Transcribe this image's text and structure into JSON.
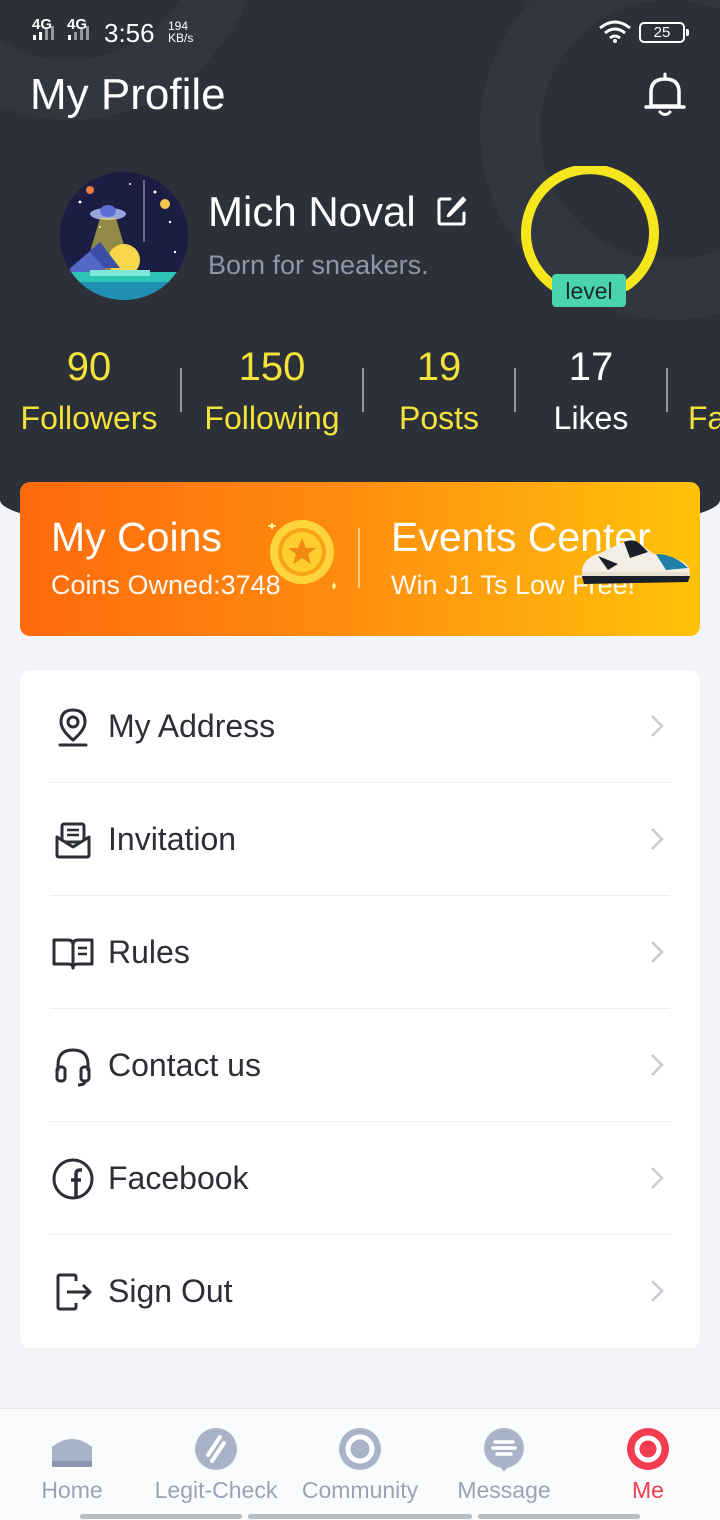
{
  "status_bar": {
    "network_1": "4G",
    "network_2": "4G",
    "time": "3:56",
    "speed_value": "194",
    "speed_unit": "KB/s",
    "battery": "25"
  },
  "header": {
    "title": "My Profile"
  },
  "profile": {
    "name": "Mich Noval",
    "bio": "Born for sneakers.",
    "level_label": "level"
  },
  "stats": [
    {
      "value": "90",
      "label": "Followers"
    },
    {
      "value": "150",
      "label": "Following"
    },
    {
      "value": "19",
      "label": "Posts"
    },
    {
      "value": "17",
      "label": "Likes"
    },
    {
      "value": "",
      "label": "Fa"
    }
  ],
  "coins_card": {
    "coins_title": "My Coins",
    "coins_sub": "Coins Owned:3748",
    "events_title": "Events Center",
    "events_sub": "Win J1 Ts Low Free!"
  },
  "menu": [
    {
      "label": "My Address",
      "icon": "location-pin-icon"
    },
    {
      "label": "Invitation",
      "icon": "invitation-icon"
    },
    {
      "label": "Rules",
      "icon": "book-icon"
    },
    {
      "label": "Contact us",
      "icon": "headset-icon"
    },
    {
      "label": "Facebook",
      "icon": "facebook-icon"
    },
    {
      "label": "Sign Out",
      "icon": "sign-out-icon"
    }
  ],
  "tabs": [
    {
      "label": "Home",
      "icon": "home-icon",
      "active": false
    },
    {
      "label": "Legit-Check",
      "icon": "legit-check-icon",
      "active": false
    },
    {
      "label": "Community",
      "icon": "community-icon",
      "active": false
    },
    {
      "label": "Message",
      "icon": "message-icon",
      "active": false
    },
    {
      "label": "Me",
      "icon": "me-icon",
      "active": true
    }
  ],
  "colors": {
    "header_bg": "#2b3039",
    "stat_yellow": "#f5e23b",
    "level_ring": "#f5e61e",
    "level_badge": "#49d3ae",
    "card_orange": "#ff6a0c",
    "card_yellow": "#ffc209",
    "tab_active": "#f23b4e",
    "tab_inactive": "#9aa3b5"
  }
}
